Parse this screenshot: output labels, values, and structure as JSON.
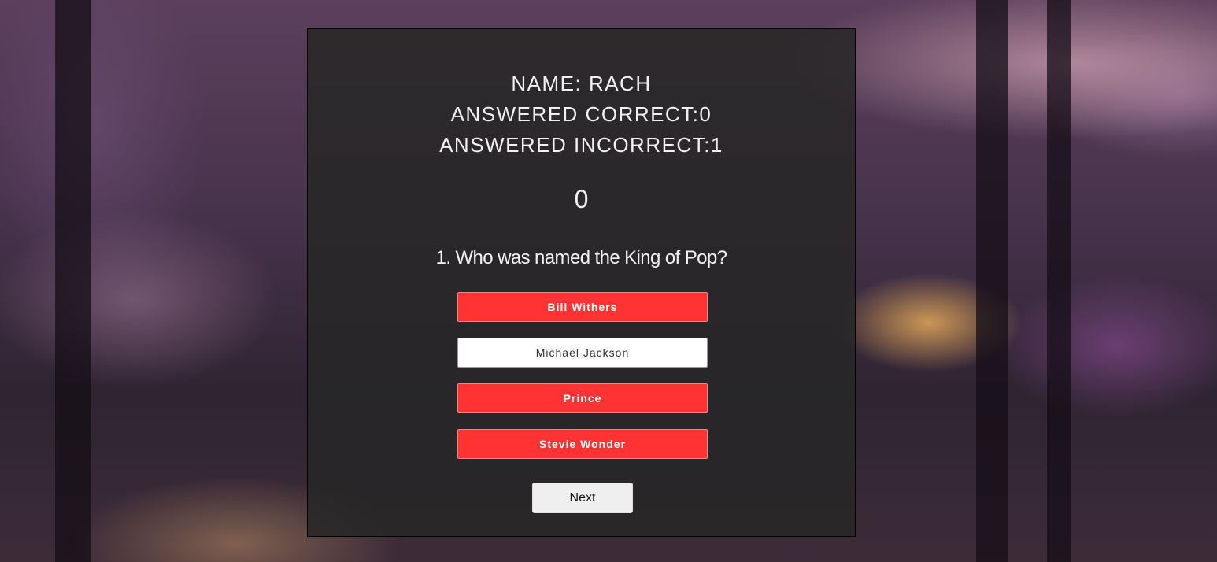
{
  "stats": {
    "name": "NAME: RACH",
    "correct": "ANSWERED CORRECT:0",
    "incorrect": "ANSWERED INCORRECT:1"
  },
  "timer": "0",
  "question": "1. Who was named the King of Pop?",
  "answers": [
    {
      "label": "Bill Withers",
      "state": "incorrect"
    },
    {
      "label": "Michael Jackson",
      "state": "selected"
    },
    {
      "label": "Prince",
      "state": "incorrect"
    },
    {
      "label": "Stevie Wonder",
      "state": "incorrect"
    }
  ],
  "next_label": "Next",
  "colors": {
    "answer_red": "#ff3333",
    "answer_white": "#ffffff",
    "card_bg": "#262626"
  }
}
